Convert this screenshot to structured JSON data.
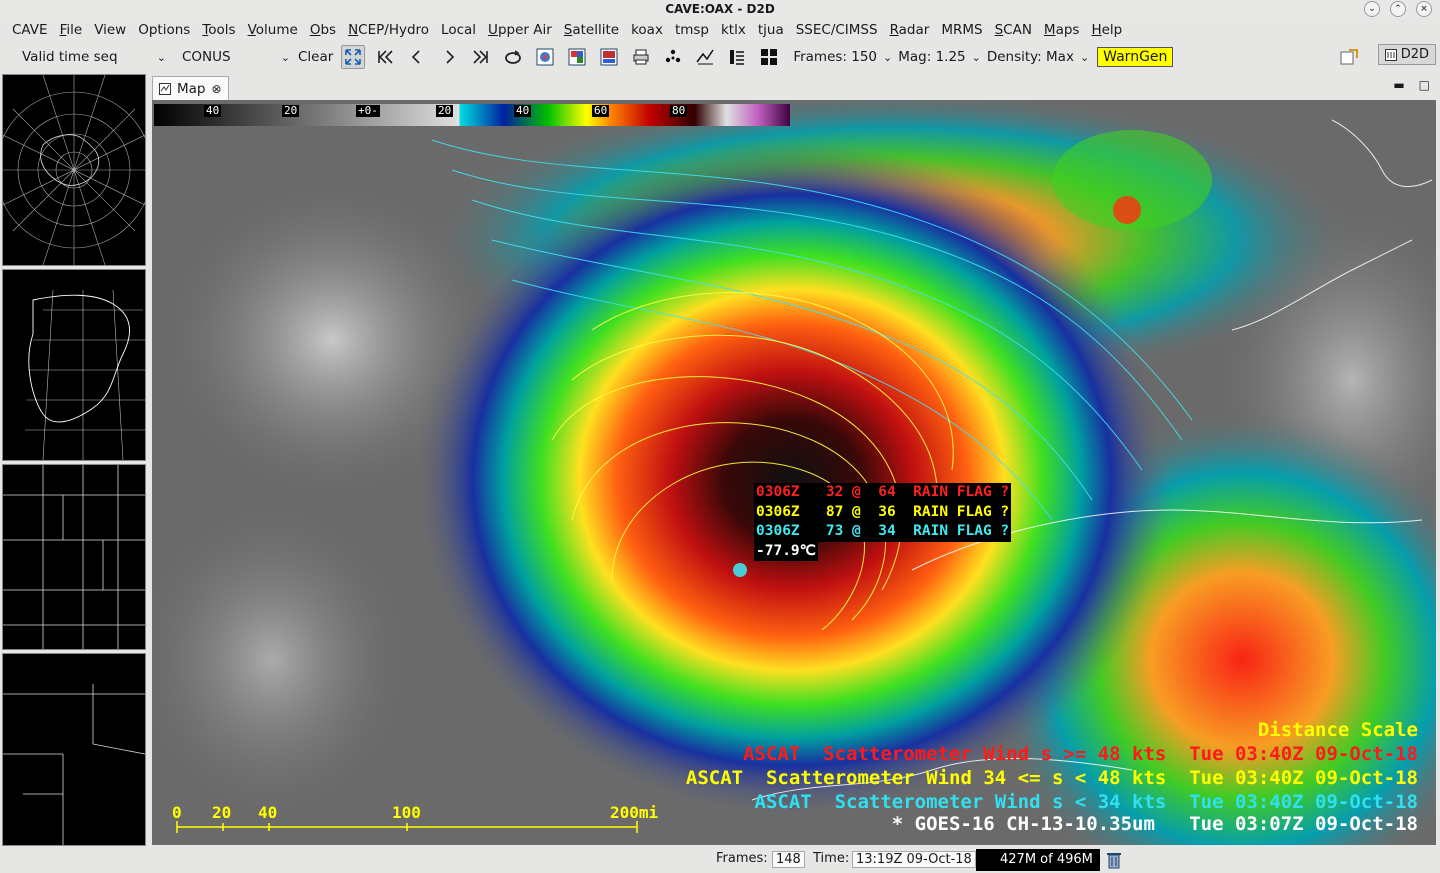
{
  "window": {
    "title": "CAVE:OAX - D2D"
  },
  "menubar": {
    "items": [
      "CAVE",
      "File",
      "View",
      "Options",
      "Tools",
      "Volume",
      "Obs",
      "NCEP/Hydro",
      "Local",
      "Upper Air",
      "Satellite",
      "koax",
      "tmsp",
      "ktlx",
      "tjua",
      "SSEC/CIMSS",
      "Radar",
      "MRMS",
      "SCAN",
      "Maps",
      "Help"
    ]
  },
  "toolbar": {
    "time_mode": "Valid time seq",
    "scale": "CONUS",
    "clear": "Clear",
    "frames": "Frames: 150",
    "mag": "Mag: 1.25",
    "density": "Density: Max",
    "warngen": "WarnGen",
    "perspective": "D2D"
  },
  "map_tab": {
    "label": "Map"
  },
  "colorbar": {
    "labels": [
      "40",
      "20",
      "+0-",
      "20",
      "40",
      "60",
      "80"
    ]
  },
  "readout": {
    "lines": [
      {
        "text": "0306Z   32 @  64  RAIN FLAG ?",
        "color": "#ff2020"
      },
      {
        "text": "0306Z   87 @  36  RAIN FLAG ?",
        "color": "#ffff00"
      },
      {
        "text": "0306Z   73 @  34  RAIN FLAG ?",
        "color": "#40e8f0"
      },
      {
        "text": "-77.9℃",
        "color": "#ffffff"
      }
    ]
  },
  "legend": {
    "lines": [
      {
        "text": "Distance Scale",
        "color": "#ffff00"
      },
      {
        "text": "ASCAT  Scatterometer Wind s >= 48 kts  Tue 03:40Z 09-Oct-18",
        "color": "#ff1a1a"
      },
      {
        "text": "ASCAT  Scatterometer Wind 34 <= s < 48 kts  Tue 03:40Z 09-Oct-18",
        "color": "#ffff00"
      },
      {
        "text": "ASCAT  Scatterometer Wind s < 34 kts  Tue 03:40Z 09-Oct-18",
        "color": "#30e0f0"
      },
      {
        "text": "* GOES-16 CH-13-10.35um   Tue 03:07Z 09-Oct-18",
        "color": "#ffffff"
      }
    ]
  },
  "distance_scale": {
    "labels": [
      "0",
      "20",
      "40",
      "100",
      "200mi"
    ]
  },
  "statusbar": {
    "frames_label": "Frames:",
    "frames_value": "148",
    "time_label": "Time:",
    "time_value": "13:19Z 09-Oct-18",
    "memory": "427M of 496M"
  }
}
